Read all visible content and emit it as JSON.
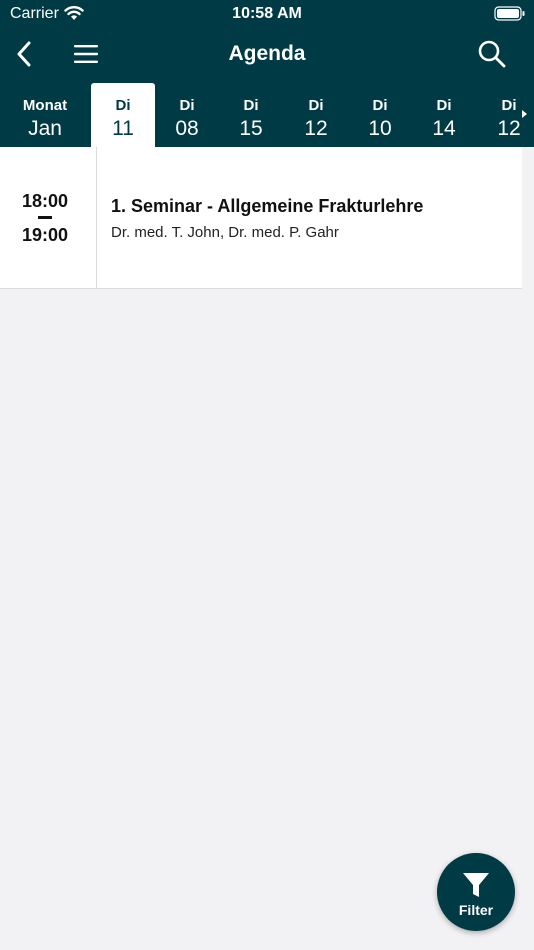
{
  "status_bar": {
    "carrier": "Carrier",
    "time": "10:58 AM"
  },
  "nav": {
    "title": "Agenda"
  },
  "date_bar": {
    "month_label": "Monat",
    "month_value": "Jan",
    "days": [
      {
        "weekday": "Di",
        "day": "11",
        "selected": true
      },
      {
        "weekday": "Di",
        "day": "08",
        "selected": false
      },
      {
        "weekday": "Di",
        "day": "15",
        "selected": false
      },
      {
        "weekday": "Di",
        "day": "12",
        "selected": false
      },
      {
        "weekday": "Di",
        "day": "10",
        "selected": false
      },
      {
        "weekday": "Di",
        "day": "14",
        "selected": false
      },
      {
        "weekday": "Di",
        "day": "12",
        "selected": false
      }
    ]
  },
  "events": [
    {
      "start": "18:00",
      "end": "19:00",
      "title": "1. Seminar - Allgemeine Frakturlehre",
      "speakers": "Dr. med. T. John, Dr. med. P. Gahr"
    }
  ],
  "filter": {
    "label": "Filter"
  },
  "colors": {
    "primary": "#003a45",
    "background": "#f2f2f4",
    "card": "#ffffff"
  },
  "icons": [
    "wifi-icon",
    "battery-icon",
    "back-icon",
    "menu-icon",
    "search-icon",
    "chevron-right-icon",
    "filter-icon"
  ]
}
